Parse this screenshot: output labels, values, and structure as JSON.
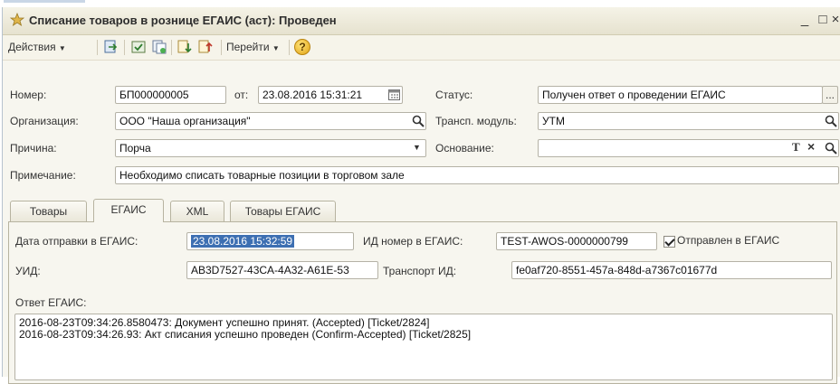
{
  "window": {
    "title": "Списание товаров в рознице ЕГАИС (аст): Проведен",
    "minimize": "_",
    "maximize": "□",
    "close": "×"
  },
  "toolbar": {
    "actions_label": "Действия",
    "goto_label": "Перейти",
    "help_label": "?"
  },
  "form": {
    "number_label": "Номер:",
    "number_value": "БП000000005",
    "from_label": "от:",
    "date_value": "23.08.2016 15:31:21",
    "status_label": "Статус:",
    "status_value": "Получен ответ о проведении ЕГАИС",
    "status_button": "...",
    "org_label": "Организация:",
    "org_value": "ООО \"Наша организация\"",
    "transport_label": "Трансп. модуль:",
    "transport_value": "УТМ",
    "reason_label": "Причина:",
    "reason_value": "Порча",
    "basis_label": "Основание:",
    "basis_value": "",
    "basis_t": "T",
    "basis_x": "×",
    "note_label": "Примечание:",
    "note_value": "Необходимо списать товарные позиции в торговом зале"
  },
  "tabs": [
    {
      "label": "Товары"
    },
    {
      "label": "ЕГАИС"
    },
    {
      "label": "XML"
    },
    {
      "label": "Товары ЕГАИС"
    }
  ],
  "egais": {
    "send_date_label": "Дата отправки в ЕГАИС:",
    "send_date_value": "23.08.2016 15:32:59",
    "id_label": "ИД номер в ЕГАИС:",
    "id_value": "TEST-AWOS-0000000799",
    "sent_label": "Отправлен в ЕГАИС",
    "sent_checked": true,
    "uid_label": "УИД:",
    "uid_value": "AB3D7527-43CA-4A32-A61E-53",
    "transport_id_label": "Транспорт ИД:",
    "transport_id_value": "fe0af720-8551-457a-848d-a7367c01677d",
    "response_label": "Ответ ЕГАИС:",
    "response_lines": [
      "2016-08-23T09:34:26.8580473: Документ успешно принят. (Accepted) [Ticket/2824]",
      "2016-08-23T09:34:26.93: Акт списания успешно проведен (Confirm-Accepted) [Ticket/2825]"
    ]
  },
  "colors": {
    "accent": "#3d6fb2",
    "panel": "#f7f6ef"
  }
}
